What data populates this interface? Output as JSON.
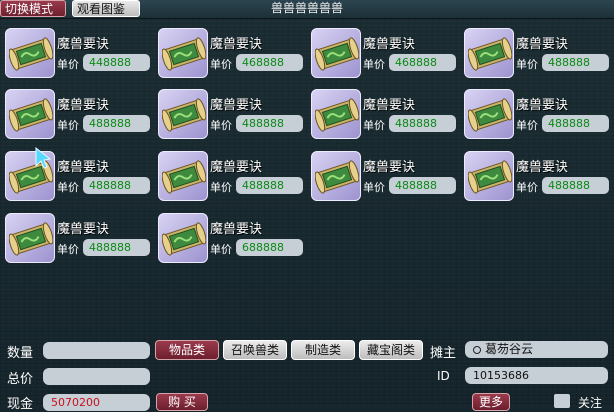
{
  "header": {
    "mode_tab": "切换模式",
    "book_tab": "观看图鉴",
    "title": "兽兽兽兽兽兽"
  },
  "price_label": "单价",
  "items": [
    {
      "name": "魔兽要诀",
      "price": "448888"
    },
    {
      "name": "魔兽要诀",
      "price": "468888"
    },
    {
      "name": "魔兽要诀",
      "price": "468888"
    },
    {
      "name": "魔兽要诀",
      "price": "488888"
    },
    {
      "name": "魔兽要诀",
      "price": "488888"
    },
    {
      "name": "魔兽要诀",
      "price": "488888"
    },
    {
      "name": "魔兽要诀",
      "price": "488888"
    },
    {
      "name": "魔兽要诀",
      "price": "488888"
    },
    {
      "name": "魔兽要诀",
      "price": "488888"
    },
    {
      "name": "魔兽要诀",
      "price": "488888"
    },
    {
      "name": "魔兽要诀",
      "price": "488888"
    },
    {
      "name": "魔兽要诀",
      "price": "488888"
    },
    {
      "name": "魔兽要诀",
      "price": "488888"
    },
    {
      "name": "魔兽要诀",
      "price": "688888"
    }
  ],
  "bottom": {
    "quantity_label": "数量",
    "total_label": "总价",
    "cash_label": "现金",
    "cash_value": "5070200",
    "buy_label": "购 买",
    "categories": [
      "物品类",
      "召唤兽类",
      "制造类",
      "藏宝阁类"
    ],
    "owner_label": "摊主",
    "owner_value": "葛芴谷云",
    "id_label": "ID",
    "id_value": "10153686",
    "more_label": "更多",
    "follow_label": "关注"
  },
  "colors": {
    "price_text": "#0a8a14",
    "cash_text": "#c8101a",
    "active_button": "#8a2c3d"
  }
}
